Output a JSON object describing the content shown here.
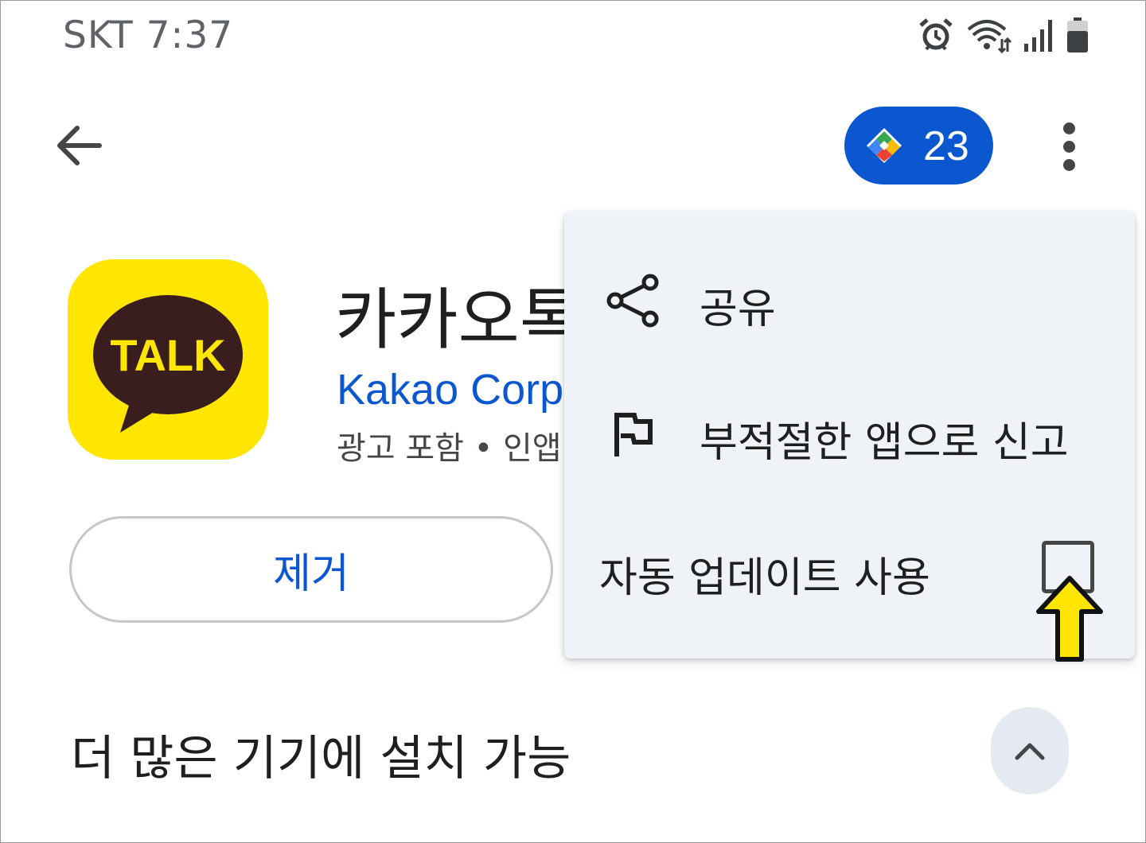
{
  "status_bar": {
    "carrier_time": "SKT 7:37",
    "icons": [
      "alarm-icon",
      "wifi-icon",
      "signal-icon",
      "battery-icon"
    ]
  },
  "top_bar": {
    "back_icon": "arrow-back-icon",
    "points": {
      "icon": "play-points-icon",
      "value": "23",
      "color": "#0b57d0"
    },
    "more_icon": "more-vert-icon"
  },
  "app": {
    "icon_text": "TALK",
    "icon_background": "#ffe600",
    "title": "카카오톡",
    "developer": "Kakao Corp",
    "meta": "광고 포함 • 인앱"
  },
  "actions": {
    "remove_label": "제거"
  },
  "menu": {
    "items": [
      {
        "icon": "share-icon",
        "label": "공유"
      },
      {
        "icon": "flag-icon",
        "label": "부적절한 앱으로 신고"
      },
      {
        "label": "자동 업데이트 사용",
        "checked": false
      }
    ]
  },
  "annotation": {
    "arrow_color": "#ffe600"
  },
  "section": {
    "title": "더 많은 기기에 설치 가능",
    "expand_icon": "chevron-up-icon"
  }
}
